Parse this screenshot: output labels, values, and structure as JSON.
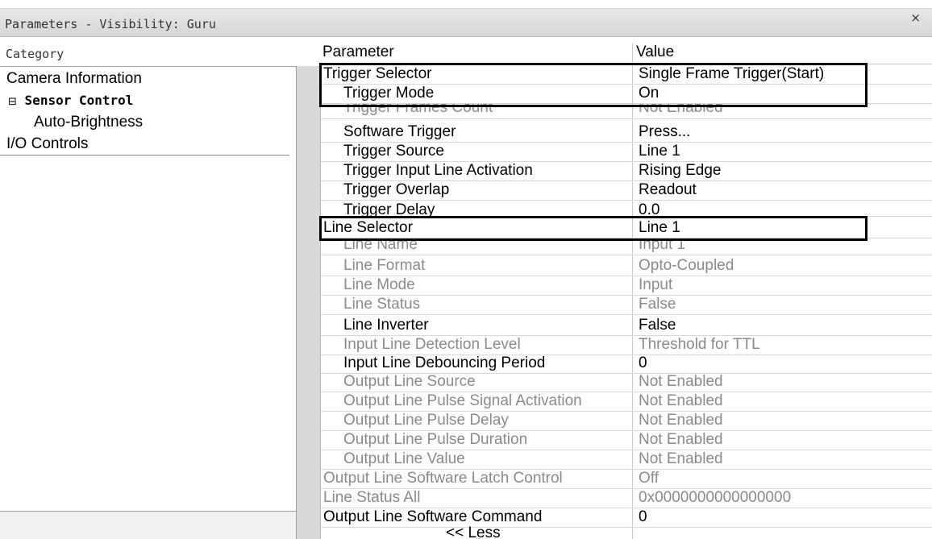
{
  "window": {
    "title": "Parameters - Visibility: Guru",
    "close_glyph": "×"
  },
  "category_panel": {
    "header": "Category",
    "items": [
      {
        "label": "Camera Information",
        "level": 0,
        "bold": false,
        "toggle": ""
      },
      {
        "label": "Sensor Control",
        "level": 0,
        "bold": true,
        "toggle": "⊟"
      },
      {
        "label": "Auto-Brightness",
        "level": 1,
        "bold": false,
        "toggle": ""
      },
      {
        "label": "I/O Controls",
        "level": 0,
        "bold": false,
        "toggle": "",
        "selected": true
      }
    ]
  },
  "grid": {
    "header_parameter": "Parameter",
    "header_value": "Value",
    "rows": [
      {
        "param": "Trigger Selector",
        "value": "Single Frame Trigger(Start)",
        "indent": 0,
        "enabled": true
      },
      {
        "param": "Trigger Mode",
        "value": "On",
        "indent": 1,
        "enabled": true
      },
      {
        "param": "Trigger Frames Count",
        "value": "Not Enabled",
        "indent": 1,
        "enabled": false
      },
      {
        "param": "Software Trigger",
        "value": "Press...",
        "indent": 1,
        "enabled": true
      },
      {
        "param": "Trigger Source",
        "value": "Line 1",
        "indent": 1,
        "enabled": true
      },
      {
        "param": "Trigger Input Line Activation",
        "value": "Rising Edge",
        "indent": 1,
        "enabled": true
      },
      {
        "param": "Trigger Overlap",
        "value": "Readout",
        "indent": 1,
        "enabled": true
      },
      {
        "param": "Trigger Delay",
        "value": "0.0",
        "indent": 1,
        "enabled": true
      },
      {
        "param": "Line Selector",
        "value": "Line 1",
        "indent": 0,
        "enabled": true
      },
      {
        "param": "Line Name",
        "value": "Input 1",
        "indent": 1,
        "enabled": false
      },
      {
        "param": "Line Format",
        "value": "Opto-Coupled",
        "indent": 1,
        "enabled": false
      },
      {
        "param": "Line Mode",
        "value": "Input",
        "indent": 1,
        "enabled": false
      },
      {
        "param": "Line Status",
        "value": "False",
        "indent": 1,
        "enabled": false
      },
      {
        "param": "Line Inverter",
        "value": "False",
        "indent": 1,
        "enabled": true
      },
      {
        "param": "Input Line Detection Level",
        "value": "Threshold for TTL",
        "indent": 1,
        "enabled": false
      },
      {
        "param": "Input Line Debouncing Period",
        "value": "0",
        "indent": 1,
        "enabled": true
      },
      {
        "param": "Output Line Source",
        "value": "Not Enabled",
        "indent": 1,
        "enabled": false
      },
      {
        "param": "Output Line Pulse Signal Activation",
        "value": "Not Enabled",
        "indent": 1,
        "enabled": false
      },
      {
        "param": "Output Line Pulse Delay",
        "value": "Not Enabled",
        "indent": 1,
        "enabled": false
      },
      {
        "param": "Output Line Pulse Duration",
        "value": "Not Enabled",
        "indent": 1,
        "enabled": false
      },
      {
        "param": "Output Line Value",
        "value": "Not Enabled",
        "indent": 1,
        "enabled": false
      },
      {
        "param": "Output Line Software Latch Control",
        "value": "Off",
        "indent": 0,
        "enabled": false
      },
      {
        "param": "Line Status All",
        "value": "0x0000000000000000",
        "indent": 0,
        "enabled": false
      },
      {
        "param": "Output Line Software Command",
        "value": "0",
        "indent": 0,
        "enabled": true
      }
    ],
    "less_button": "<< Less"
  },
  "colors": {
    "disabled_text": "#8a8a8a",
    "highlight_box": "#000000"
  }
}
